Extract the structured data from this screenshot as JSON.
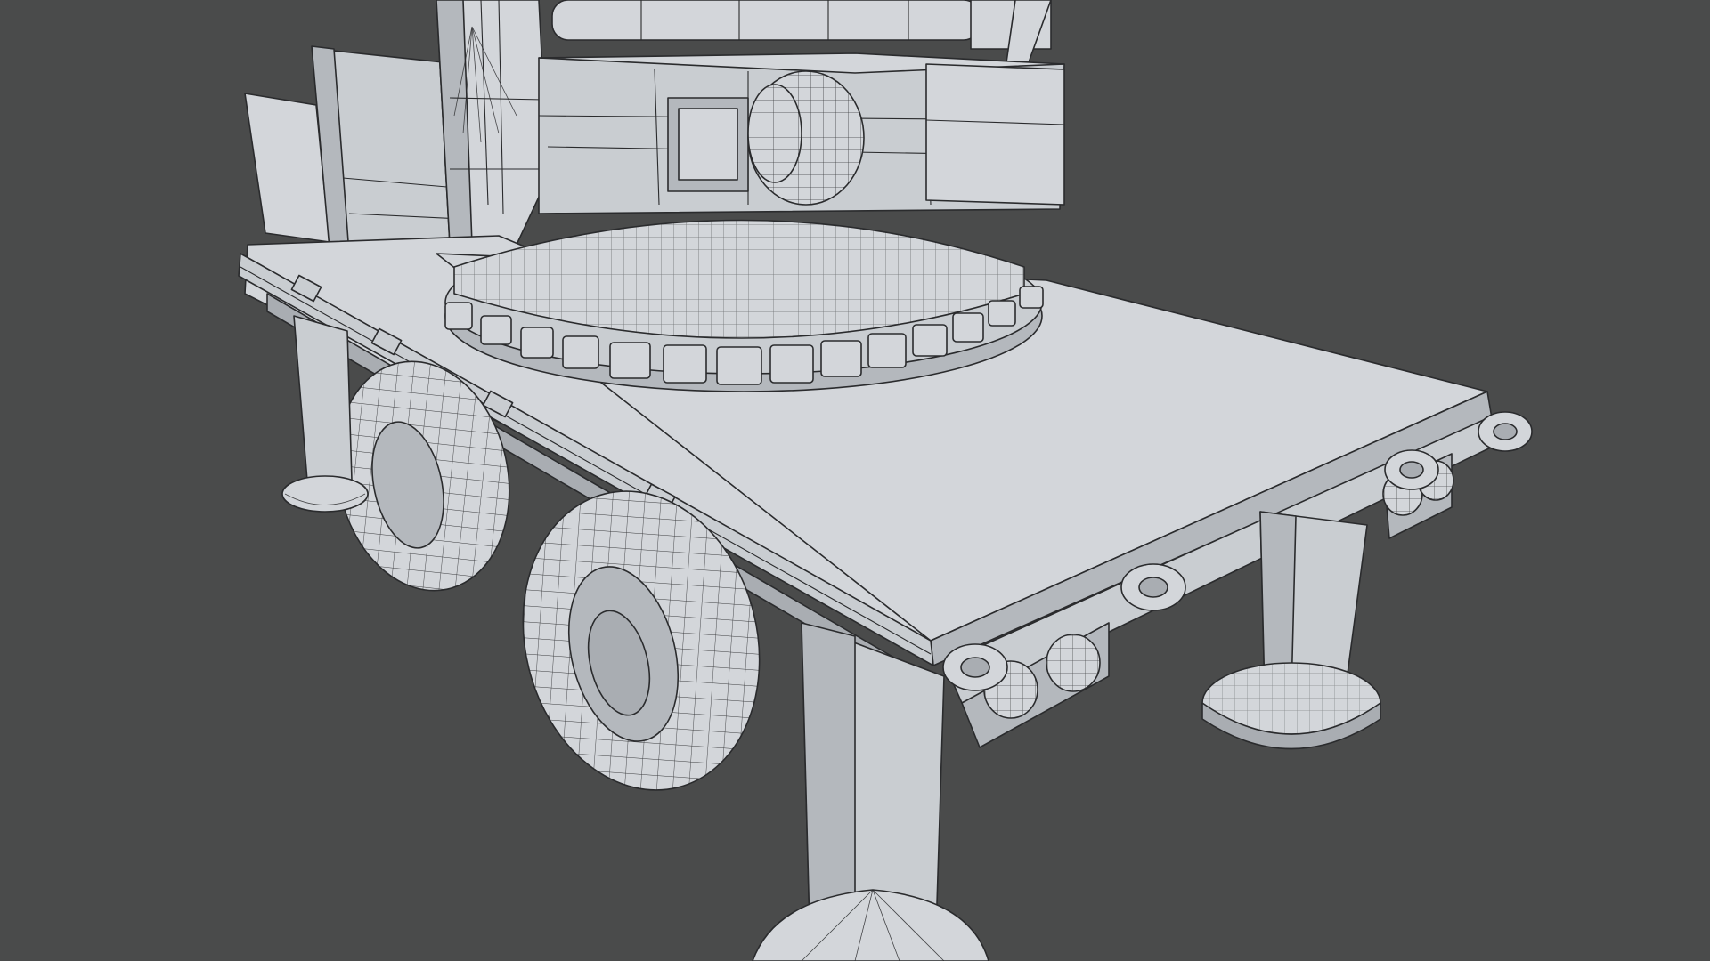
{
  "viewport": {
    "background": "#4a4b4b",
    "model_fill": "#c9cdd1",
    "wire_color": "#2a2b2d"
  }
}
